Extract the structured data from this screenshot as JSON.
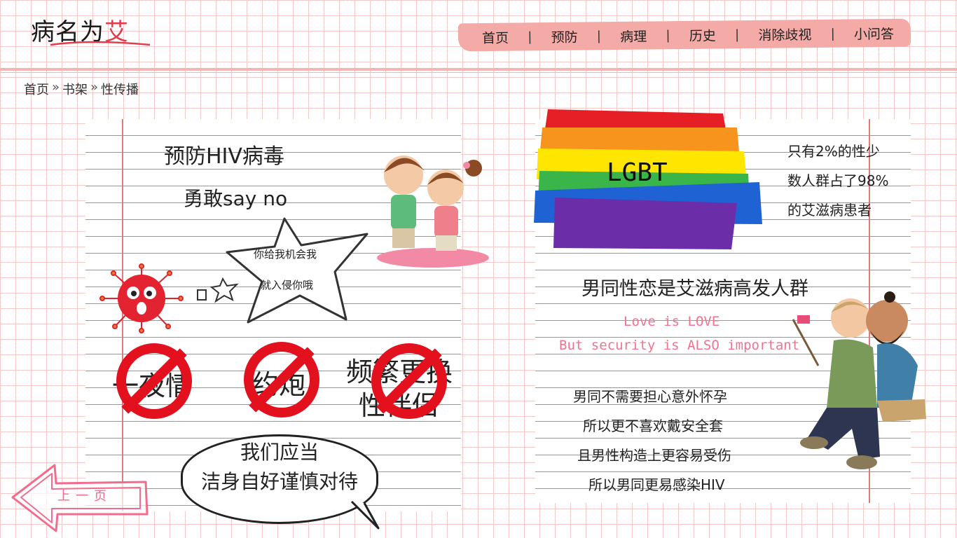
{
  "header": {
    "logo_text": "病名为",
    "logo_accent": "艾",
    "nav": [
      {
        "label": "首页"
      },
      {
        "label": "预防"
      },
      {
        "label": "病理"
      },
      {
        "label": "历史"
      },
      {
        "label": "消除歧视"
      },
      {
        "label": "小问答"
      }
    ],
    "nav_separator": "|"
  },
  "breadcrumb": {
    "items": [
      "首页",
      "书架",
      "性传播"
    ],
    "separator": "»"
  },
  "left_page": {
    "title": "预防HIV病毒",
    "subtitle": "勇敢say no",
    "bubble_line1": "你给我机会我",
    "bubble_line2": "就入侵你哦",
    "banned": [
      {
        "text": "一夜情"
      },
      {
        "text": "约炮"
      },
      {
        "text_line1": "频繁更换",
        "text_line2": "性伴侣"
      }
    ],
    "speech_line1": "我们应当",
    "speech_line2": "洁身自好谨慎对待",
    "back_label": "上一页"
  },
  "right_page": {
    "rainbow_label": "LGBT",
    "stat_line1": "只有2%的性少",
    "stat_line2": "数人群占了98%",
    "stat_line3": "的艾滋病患者",
    "headline": "男同性恋是艾滋病高发人群",
    "love_line": "Love is LOVE",
    "security_line": "But security is ALSO important",
    "lines": [
      "男同不需要担心意外怀孕",
      "所以更不喜欢戴安全套",
      "且男性构造上更容易受伤",
      "所以男同更易感染HIV"
    ]
  },
  "colors": {
    "grid": "#f3c9c9",
    "nav_bg": "#f4aaa6",
    "ban_red": "#e3101e",
    "pink_text": "#f2738f",
    "notebook_line": "#8a93d6"
  },
  "icons": [
    "virus-icon",
    "ban-icon",
    "back-arrow-icon",
    "rainbow-flag-icon"
  ]
}
